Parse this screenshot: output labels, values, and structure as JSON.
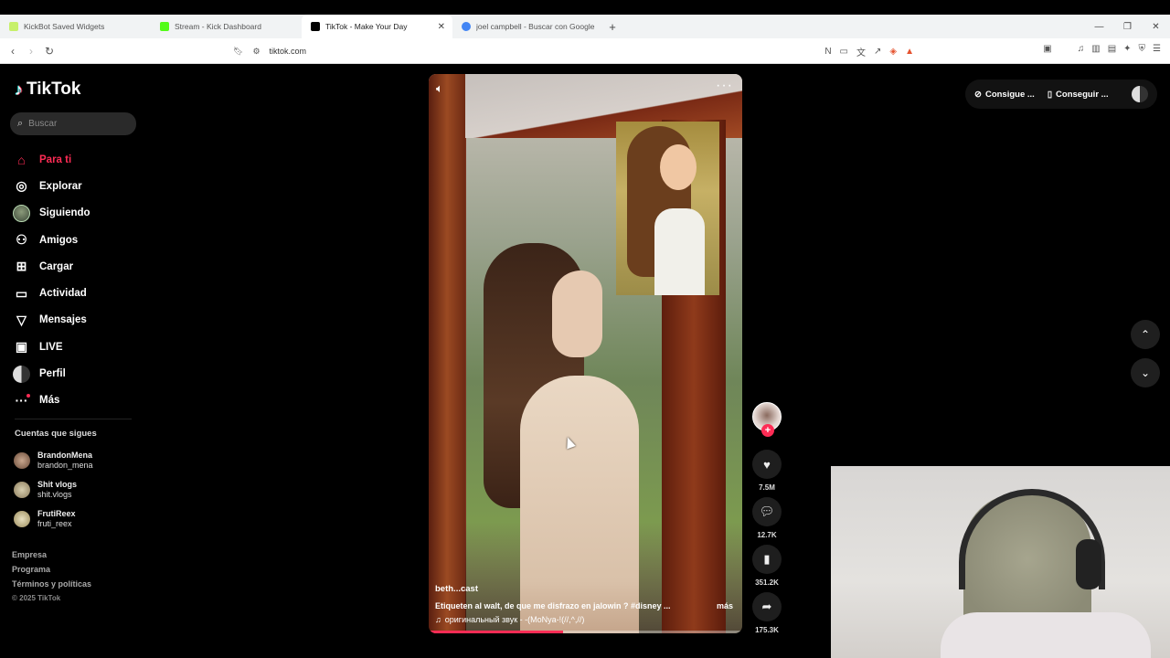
{
  "browser": {
    "tabs": [
      {
        "title": "KickBot Saved Widgets",
        "favicon_color": "#c7f06a"
      },
      {
        "title": "Stream - Kick Dashboard",
        "favicon_color": "#53fc18"
      },
      {
        "title": "TikTok - Make Your Day",
        "favicon_color": "#000000"
      },
      {
        "title": "joel campbell - Buscar con Google",
        "favicon_color": "#4285f4"
      }
    ],
    "url": "tiktok.com"
  },
  "sidebar": {
    "logo_text": "TikTok",
    "search_placeholder": "Buscar",
    "nav": [
      {
        "label": "Para ti",
        "icon": "home-icon"
      },
      {
        "label": "Explorar",
        "icon": "compass-icon"
      },
      {
        "label": "Siguiendo",
        "icon": "following-avatar-icon"
      },
      {
        "label": "Amigos",
        "icon": "friends-icon"
      },
      {
        "label": "Cargar",
        "icon": "upload-icon"
      },
      {
        "label": "Actividad",
        "icon": "activity-icon"
      },
      {
        "label": "Mensajes",
        "icon": "messages-icon"
      },
      {
        "label": "LIVE",
        "icon": "live-icon"
      },
      {
        "label": "Perfil",
        "icon": "profile-icon"
      },
      {
        "label": "Más",
        "icon": "more-icon"
      }
    ],
    "following_heading": "Cuentas que sigues",
    "following": [
      {
        "name": "BrandonMena",
        "handle": "brandon_mena",
        "avatar_color": "#7a5a48"
      },
      {
        "name": "Shit vlogs",
        "handle": "shit.vlogs",
        "avatar_color": "#9a8a6a"
      },
      {
        "name": "FrutiReex",
        "handle": "fruti_reex",
        "avatar_color": "#b0a070"
      }
    ],
    "footer": [
      "Empresa",
      "Programa",
      "Términos y políticas"
    ],
    "copyright": "© 2025 TikTok"
  },
  "video": {
    "author": "beth...cast",
    "description": "Etiqueten al walt, de que me disfrazo en jalowin ? #disney ...",
    "more_label": "más",
    "sound": "оригинальный звук - -(MoNya-!(//,^,//)",
    "progress": 0.43
  },
  "actions": {
    "likes": "7.5M",
    "comments": "12.7K",
    "saves": "351.2K",
    "shares": "175.3K"
  },
  "header_right": {
    "btn1": "Consigue ...",
    "btn2": "Conseguir ..."
  },
  "colors": {
    "accent": "#fe2c55"
  }
}
